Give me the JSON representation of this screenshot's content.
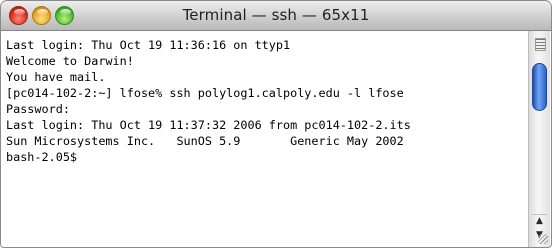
{
  "window": {
    "title": "Terminal — ssh — 65x11",
    "buttons": {
      "close": {
        "icon": "close-icon",
        "color": "#d8261c"
      },
      "minimize": {
        "icon": "minimize-icon",
        "color": "#e6a218"
      },
      "zoom": {
        "icon": "zoom-icon",
        "color": "#48b82a"
      }
    }
  },
  "terminal": {
    "lines": [
      "Last login: Thu Oct 19 11:36:16 on ttyp1",
      "Welcome to Darwin!",
      "You have mail.",
      "[pc014-102-2:~] lfose% ssh polylog1.calpoly.edu -l lfose",
      "Password:",
      "Last login: Thu Oct 19 11:37:32 2006 from pc014-102-2.its",
      "Sun Microsystems Inc.   SunOS 5.9       Generic May 2002",
      "bash-2.05$"
    ]
  },
  "scrollbar": {
    "up_icon": "arrow-up-icon",
    "down_icon": "arrow-down-icon",
    "thumb_color": "#3a73d6"
  }
}
